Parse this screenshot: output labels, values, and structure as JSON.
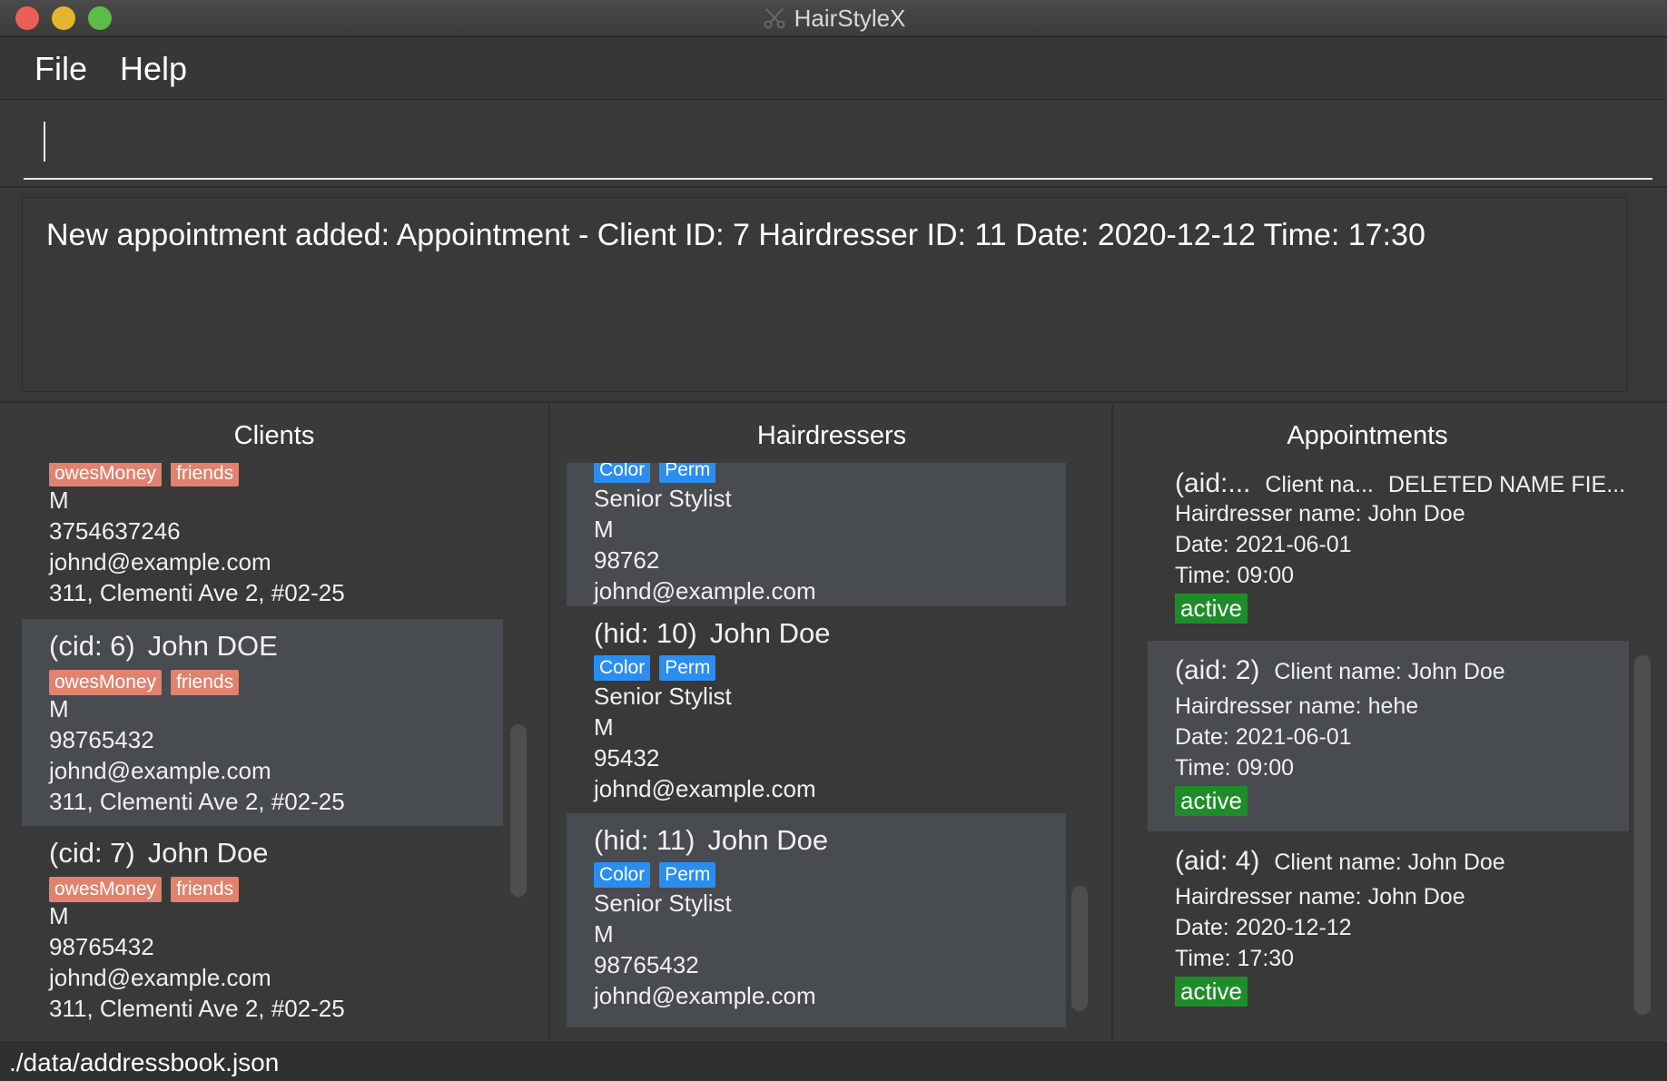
{
  "window": {
    "title": "HairStyleX"
  },
  "menu": {
    "file": "File",
    "help": "Help"
  },
  "command": {
    "value": ""
  },
  "result": {
    "text": "New appointment added: Appointment - Client ID: 7 Hairdresser ID: 11 Date: 2020-12-12 Time: 17:30"
  },
  "clients": {
    "title": "Clients",
    "partial": {
      "tags": [
        "owesMoney",
        "friends"
      ],
      "gender": "M",
      "phone": "3754637246",
      "email": "johnd@example.com",
      "address": "311, Clementi Ave 2, #02-25"
    },
    "items": [
      {
        "id": "(cid: 6)",
        "name": "John DOE",
        "tags": [
          "owesMoney",
          "friends"
        ],
        "gender": "M",
        "phone": "98765432",
        "email": "johnd@example.com",
        "address": "311, Clementi Ave 2, #02-25"
      },
      {
        "id": "(cid: 7)",
        "name": "John Doe",
        "tags": [
          "owesMoney",
          "friends"
        ],
        "gender": "M",
        "phone": "98765432",
        "email": "johnd@example.com",
        "address": "311, Clementi Ave 2, #02-25"
      }
    ]
  },
  "hairdressers": {
    "title": "Hairdressers",
    "partial": {
      "tags": [
        "Color",
        "Perm"
      ],
      "title": "Senior Stylist",
      "gender": "M",
      "phone": "98762",
      "email": "johnd@example.com"
    },
    "items": [
      {
        "id": "(hid: 10)",
        "name": "John Doe",
        "tags": [
          "Color",
          "Perm"
        ],
        "title": "Senior Stylist",
        "gender": "M",
        "phone": "95432",
        "email": "johnd@example.com"
      },
      {
        "id": "(hid: 11)",
        "name": "John Doe",
        "tags": [
          "Color",
          "Perm"
        ],
        "title": "Senior Stylist",
        "gender": "M",
        "phone": "98765432",
        "email": "johnd@example.com"
      }
    ]
  },
  "appointments": {
    "title": "Appointments",
    "items": [
      {
        "id": "(aid:...",
        "client": "Client na...",
        "extra": "DELETED NAME FIE...",
        "hairdresser": "Hairdresser name: John Doe",
        "date": "Date: 2021-06-01",
        "time": "Time: 09:00",
        "status": "active"
      },
      {
        "id": "(aid: 2)",
        "client": "Client name:  John Doe",
        "extra": "",
        "hairdresser": "Hairdresser name: hehe",
        "date": "Date: 2021-06-01",
        "time": "Time: 09:00",
        "status": "active"
      },
      {
        "id": "(aid: 4)",
        "client": "Client name:  John Doe",
        "extra": "",
        "hairdresser": "Hairdresser name: John Doe",
        "date": "Date: 2020-12-12",
        "time": "Time: 17:30",
        "status": "active"
      }
    ]
  },
  "statusbar": {
    "path": "./data/addressbook.json"
  },
  "colors": {
    "tag_client": "#e0826e",
    "tag_hairdresser": "#2a8ef0",
    "status_active": "#1f8c2a",
    "selected_card": "#484b4f"
  },
  "icons": {
    "app": "scissors-icon"
  }
}
